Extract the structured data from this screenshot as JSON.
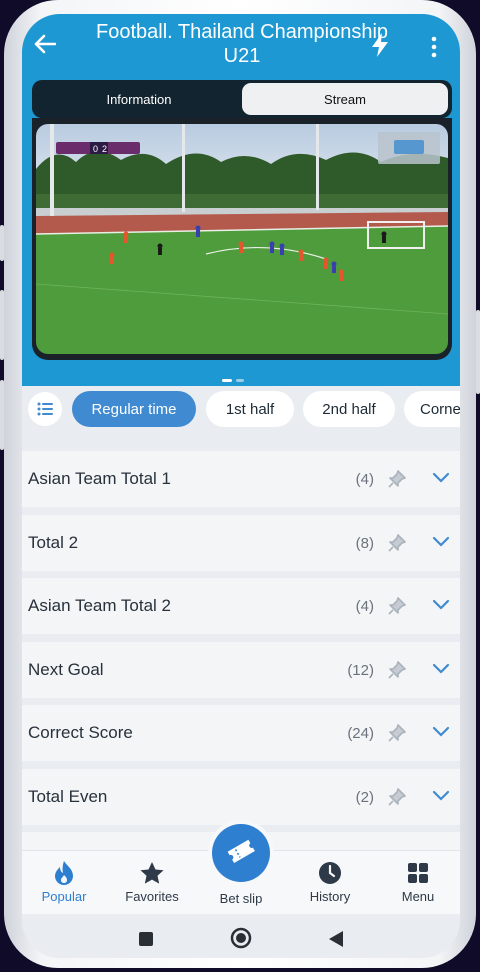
{
  "header": {
    "title": "Football. Thailand Championship U21",
    "back_icon": "arrow-left-icon",
    "flash_icon": "lightning-icon",
    "more_icon": "more-vertical-icon"
  },
  "tabs": [
    {
      "label": "Information",
      "active": false
    },
    {
      "label": "Stream",
      "active": true
    }
  ],
  "video": {
    "scoreboard_left": "0",
    "scoreboard_right": "2",
    "pager_dots": 2,
    "pager_active": 1
  },
  "period_chips": [
    {
      "label": "Regular time",
      "active": true
    },
    {
      "label": "1st half",
      "active": false
    },
    {
      "label": "2nd half",
      "active": false
    },
    {
      "label": "Corne",
      "active": false
    }
  ],
  "markets": [
    {
      "label": "Asian Team Total 1",
      "count": "(4)"
    },
    {
      "label": "Total 2",
      "count": "(8)"
    },
    {
      "label": "Asian Team Total 2",
      "count": "(4)"
    },
    {
      "label": "Next Goal",
      "count": "(12)"
    },
    {
      "label": "Correct Score",
      "count": "(24)"
    },
    {
      "label": "Total Even",
      "count": "(2)"
    }
  ],
  "bottom_nav": [
    {
      "label": "Popular",
      "icon": "flame-icon",
      "active": true
    },
    {
      "label": "Favorites",
      "icon": "star-icon",
      "active": false
    },
    {
      "label": "Bet slip",
      "icon": "ticket-icon",
      "active": false
    },
    {
      "label": "History",
      "icon": "clock-icon",
      "active": false
    },
    {
      "label": "Menu",
      "icon": "grid-icon",
      "active": false
    }
  ],
  "colors": {
    "header_bg": "#1e98d3",
    "accent": "#2f7fd0",
    "chip_active": "#3f8ad1",
    "background": "#0f0b28"
  }
}
